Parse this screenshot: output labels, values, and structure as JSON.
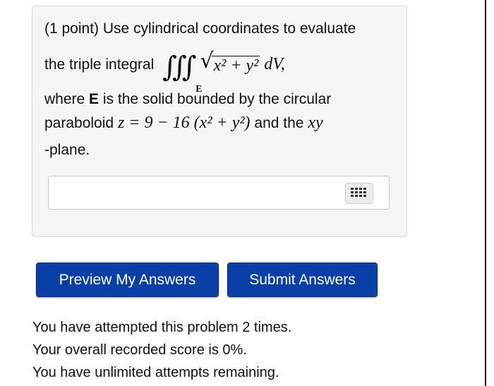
{
  "problem": {
    "line1": "(1 point) Use cylindrical coordinates to evaluate",
    "line2_prefix": "the triple integral",
    "integral_symbols": "∫∫∫",
    "region_subscript": "E",
    "integrand_base": "x² + y²",
    "differential": "dV",
    "line2_suffix": ",",
    "line3_prefix": "where",
    "line3_bold": "E",
    "line3_suffix": "is the solid bounded by the circular",
    "line4_prefix": "paraboloid",
    "surface_equation": "z = 9 − 16 (x² + y²)",
    "line4_middle": "and the",
    "plane_name": "xy",
    "line5": "-plane."
  },
  "answer": {
    "value": "",
    "keypad_icon": "grid-keypad-icon"
  },
  "buttons": {
    "preview": "Preview My Answers",
    "submit": "Submit Answers"
  },
  "status": {
    "attempts": "You have attempted this problem 2 times.",
    "score": "Your overall recorded score is 0%.",
    "remaining": "You have unlimited attempts remaining."
  },
  "colors": {
    "button_blue": "#0a3fa8",
    "panel_bg": "#f5f5f5"
  }
}
